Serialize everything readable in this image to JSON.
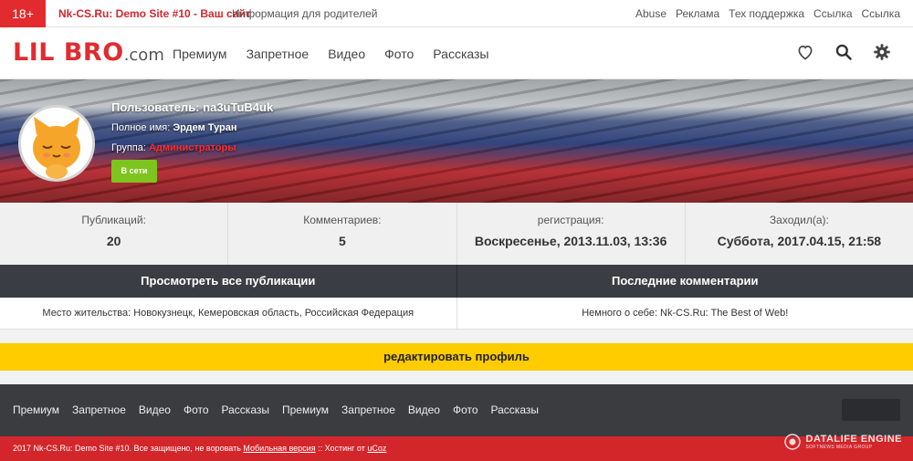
{
  "topbar": {
    "age_badge": "18+",
    "site_name": "Nk-CS.Ru: Demo Site #10 - Ваш сайт",
    "parents_link": "Информация для родителей",
    "links": [
      "Abuse",
      "Реклама",
      "Тех поддержка",
      "Ссылка",
      "Ссылка"
    ]
  },
  "header": {
    "logo_main": "LIL BRO",
    "logo_domain": ".com",
    "nav": [
      "Премиум",
      "Запретное",
      "Видео",
      "Фото",
      "Рассказы"
    ],
    "icons": [
      "heart-icon",
      "search-icon",
      "gear-icon"
    ]
  },
  "profile": {
    "user_label": "Пользователь:",
    "user_value": "na3uTuB4uk",
    "fullname_label": "Полное имя:",
    "fullname_value": "Эрдем Туран",
    "group_label": "Группа:",
    "group_value": "Администраторы",
    "online_label": "В сети"
  },
  "stats": [
    {
      "label": "Публикаций:",
      "value": "20"
    },
    {
      "label": "Комментариев:",
      "value": "5"
    },
    {
      "label": "регистрация:",
      "value": "Воскресенье, 2013.11.03, 13:36"
    },
    {
      "label": "Заходил(а):",
      "value": "Суббота, 2017.04.15, 21:58"
    }
  ],
  "actions": {
    "view_publications": "Просмотреть все публикации",
    "last_comments": "Последние комментарии",
    "edit_profile": "редактировать профиль"
  },
  "info": {
    "residence": "Место жительства: Новокузнецк, Кемеровская область, Российская Федерация",
    "about": "Немного о себе: Nk-CS.Ru: The Best of Web!"
  },
  "footer": {
    "nav": [
      "Премиум",
      "Запретное",
      "Видео",
      "Фото",
      "Рассказы",
      "Премиум",
      "Запретное",
      "Видео",
      "Фото",
      "Рассказы"
    ],
    "copyright": "2017 Nk-CS.Ru: Demo Site #10. Все защищено, не воровать",
    "mobile_link": "Мобильная версия",
    "separator": "::",
    "hosting_text": "Хостинг от",
    "hosting_link": "uCoz",
    "engine_name": "DATALIFE ENGINE",
    "engine_sub": "SOFTNEWS MEDIA GROUP"
  },
  "colors": {
    "brand_red": "#e12b2f",
    "accent_yellow": "#ffcc00",
    "online_green": "#7ec41f",
    "dark": "#3a3d43"
  }
}
